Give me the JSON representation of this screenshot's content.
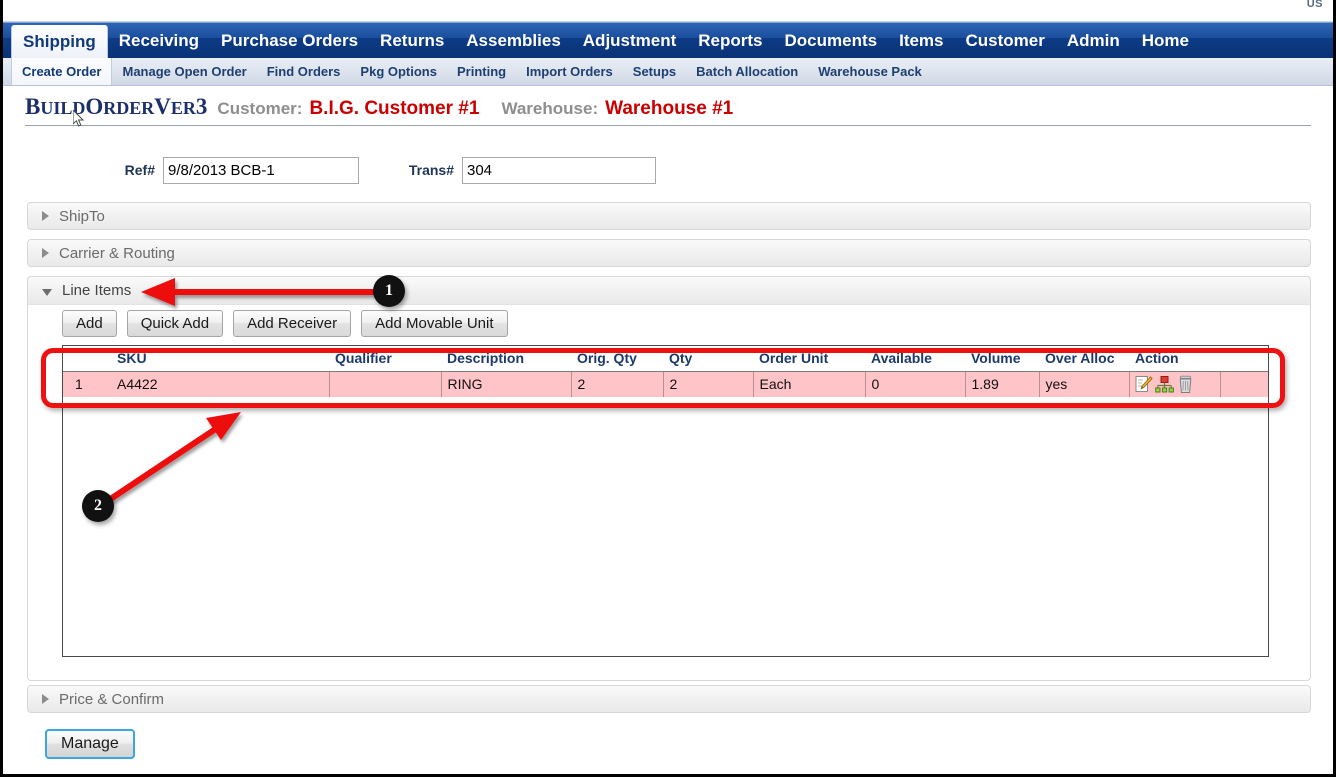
{
  "top_bar": {
    "corner_text": "US"
  },
  "nav_main": {
    "items": [
      {
        "label": "Shipping",
        "active": true
      },
      {
        "label": "Receiving",
        "active": false
      },
      {
        "label": "Purchase Orders",
        "active": false
      },
      {
        "label": "Returns",
        "active": false
      },
      {
        "label": "Assemblies",
        "active": false
      },
      {
        "label": "Adjustment",
        "active": false
      },
      {
        "label": "Reports",
        "active": false
      },
      {
        "label": "Documents",
        "active": false
      },
      {
        "label": "Items",
        "active": false
      },
      {
        "label": "Customer",
        "active": false
      },
      {
        "label": "Admin",
        "active": false
      },
      {
        "label": "Home",
        "active": false
      }
    ]
  },
  "nav_sub": {
    "items": [
      {
        "label": "Create Order",
        "active": true
      },
      {
        "label": "Manage Open Order",
        "active": false
      },
      {
        "label": "Find Orders",
        "active": false
      },
      {
        "label": "Pkg Options",
        "active": false
      },
      {
        "label": "Printing",
        "active": false
      },
      {
        "label": "Import Orders",
        "active": false
      },
      {
        "label": "Setups",
        "active": false
      },
      {
        "label": "Batch Allocation",
        "active": false
      },
      {
        "label": "Warehouse Pack",
        "active": false
      }
    ]
  },
  "header": {
    "app_title": "BuildOrderVer3",
    "customer_label": "Customer:",
    "customer_value": "B.I.G. Customer #1",
    "warehouse_label": "Warehouse:",
    "warehouse_value": "Warehouse #1"
  },
  "form": {
    "ref_label": "Ref#",
    "ref_value": "9/8/2013 BCB-1",
    "ref_placeholder": "",
    "trans_label": "Trans#",
    "trans_value": "304",
    "trans_placeholder": ""
  },
  "sections": {
    "shipto": {
      "label": "ShipTo",
      "expanded": false
    },
    "carrier": {
      "label": "Carrier & Routing",
      "expanded": false
    },
    "line_items": {
      "label": "Line Items",
      "expanded": true
    },
    "price_confirm": {
      "label": "Price & Confirm",
      "expanded": false
    }
  },
  "toolbar": {
    "add_label": "Add",
    "quick_add_label": "Quick Add",
    "add_receiver_label": "Add Receiver",
    "add_movable_unit_label": "Add Movable Unit"
  },
  "grid": {
    "columns": [
      "",
      "SKU",
      "Qualifier",
      "Description",
      "Orig. Qty",
      "Qty",
      "Order Unit",
      "Available",
      "Volume",
      "Over Alloc",
      "Action",
      ""
    ],
    "rows": [
      {
        "num": "1",
        "sku": "A4422",
        "qualifier": "",
        "description": "RING",
        "orig_qty": "2",
        "qty": "2",
        "order_unit": "Each",
        "available": "0",
        "volume": "1.89",
        "over_alloc": "yes",
        "actions": [
          "edit-icon",
          "allocate-icon",
          "delete-icon"
        ]
      }
    ]
  },
  "footer": {
    "manage_label": "Manage"
  },
  "annotations": [
    {
      "id": "1",
      "label": "1"
    },
    {
      "id": "2",
      "label": "2"
    }
  ],
  "colors": {
    "nav_blue": "#0d3b86",
    "accent_red": "#cc0000",
    "row_highlight": "#ffc4c8",
    "annotation_red": "#ee1111",
    "header_text_blue": "#1b3a6b"
  }
}
